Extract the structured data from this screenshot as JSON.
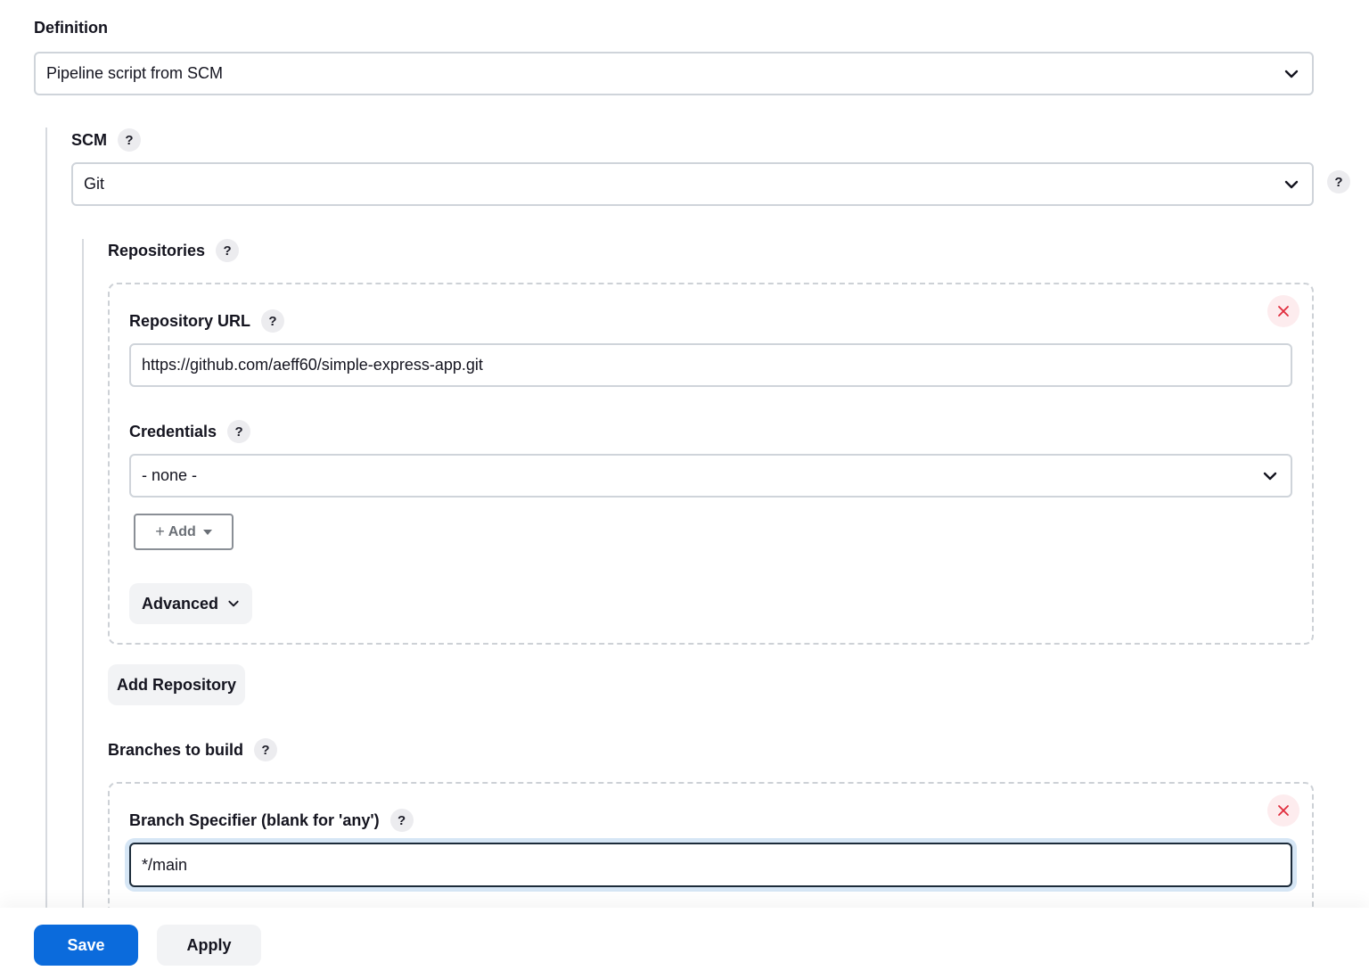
{
  "definition": {
    "label": "Definition",
    "value": "Pipeline script from SCM"
  },
  "scm": {
    "label": "SCM",
    "help": "?",
    "value": "Git",
    "side_help": "?"
  },
  "repositories": {
    "label": "Repositories",
    "help": "?",
    "repository_url": {
      "label": "Repository URL",
      "help": "?",
      "value": "https://github.com/aeff60/simple-express-app.git"
    },
    "credentials": {
      "label": "Credentials",
      "help": "?",
      "value": "- none -",
      "add_label": "Add"
    },
    "advanced_label": "Advanced",
    "add_repository_label": "Add Repository"
  },
  "branches": {
    "label": "Branches to build",
    "help": "?",
    "specifier": {
      "label": "Branch Specifier (blank for 'any')",
      "help": "?",
      "value": "*/main"
    }
  },
  "footer": {
    "save_label": "Save",
    "apply_label": "Apply"
  },
  "colors": {
    "primary": "#0b6bdc",
    "focus_border": "#1c2b3a",
    "delete_bg": "#fdecee",
    "delete_x": "#e02b3c"
  }
}
